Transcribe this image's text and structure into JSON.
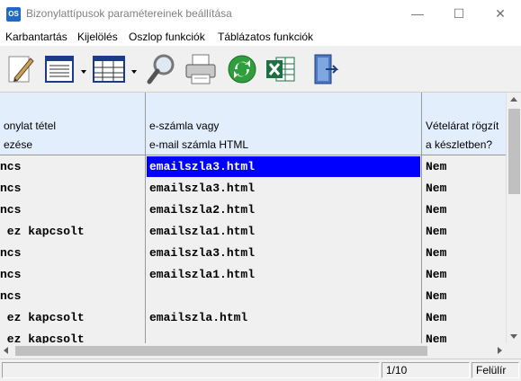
{
  "window": {
    "title": "Bizonylattípusok paramétereinek beállítása",
    "app_icon_text": "OS",
    "minimize_glyph": "—",
    "maximize_glyph": "☐",
    "close_glyph": "✕"
  },
  "menu": [
    "Karbantartás",
    "Kijelölés",
    "Oszlop funkciók",
    "Táblázatos funkciók"
  ],
  "toolbar": {
    "icons": [
      "edit-pencil-icon",
      "form-view-icon",
      "table-view-icon",
      "search-magnifier-icon",
      "print-icon",
      "refresh-icon",
      "excel-export-icon",
      "exit-door-icon"
    ]
  },
  "grid": {
    "columns": [
      {
        "line1": "onylat tétel",
        "line2": "ezése"
      },
      {
        "line1": "e-számla vagy",
        "line2": "e-mail számla HTML"
      },
      {
        "line1": "Vételárat rögzít",
        "line2": "a készletben?"
      }
    ],
    "rows": [
      [
        "ncs",
        "emailszla3.html",
        "Nem"
      ],
      [
        "ncs",
        "emailszla3.html",
        "Nem"
      ],
      [
        "ncs",
        "emailszla2.html",
        "Nem"
      ],
      [
        " ez kapcsolt",
        "emailszla1.html",
        "Nem"
      ],
      [
        "ncs",
        "emailszla3.html",
        "Nem"
      ],
      [
        "ncs",
        "emailszla1.html",
        "Nem"
      ],
      [
        "ncs",
        "",
        "Nem"
      ],
      [
        " ez kapcsolt",
        "emailszla.html",
        "Nem"
      ],
      [
        " ez kapcsolt",
        "",
        "Nem"
      ]
    ],
    "selected_row": 0,
    "selection_color": "#0000ff",
    "header_color": "#e3eefc"
  },
  "status": {
    "record": "1/10",
    "mode": "Felülír"
  }
}
